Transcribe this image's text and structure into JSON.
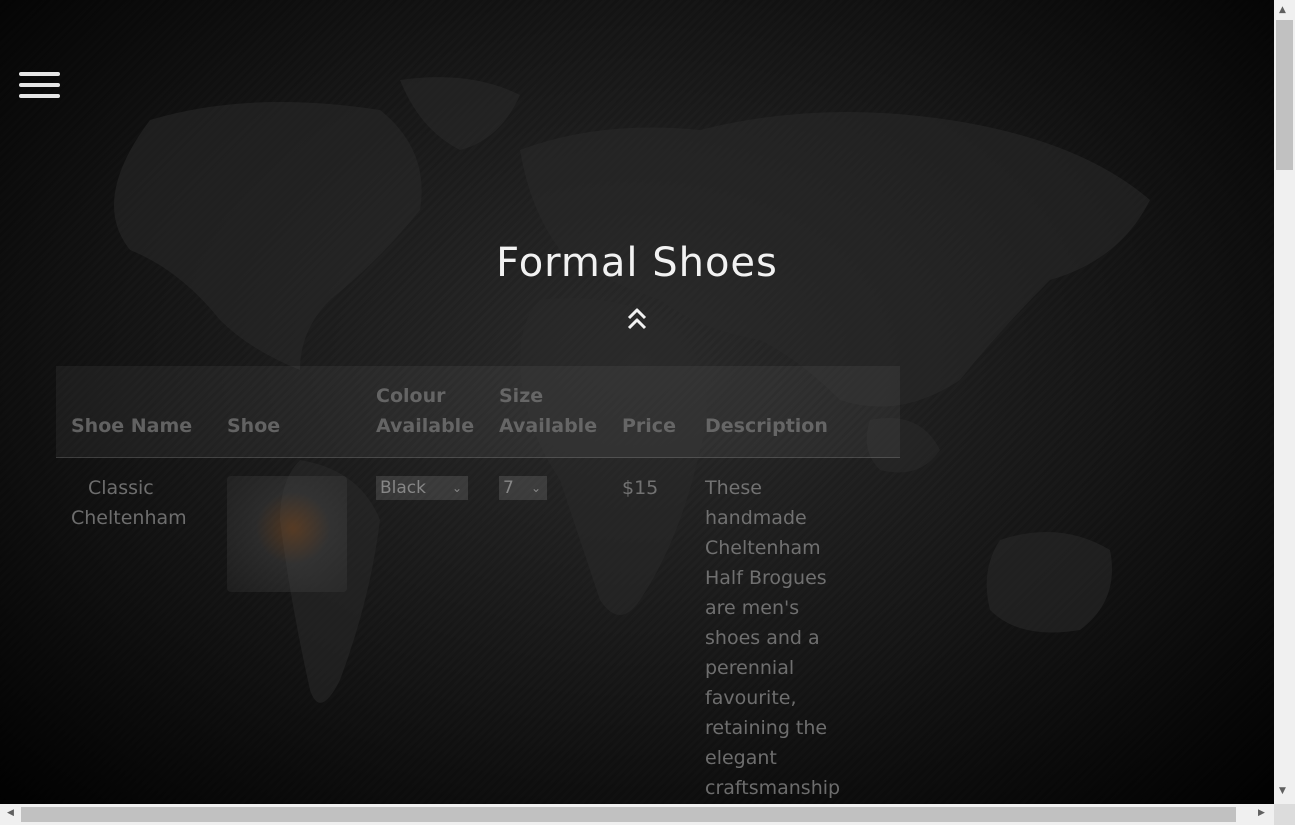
{
  "hero": {
    "title": "Formal Shoes"
  },
  "table": {
    "headers": {
      "name": "Shoe Name",
      "shoe": "Shoe",
      "colour_line1": "Colour",
      "colour_line2": "Available",
      "size_line1": "Size",
      "size_line2": "Available",
      "price": "Price",
      "description": "Description"
    },
    "rows": [
      {
        "name_line1": "Classic",
        "name_line2": "Cheltenham",
        "colour": "Black",
        "size": "7",
        "price": "$15",
        "description_lines": [
          "These",
          "handmade",
          "Cheltenham",
          "Half Brogues",
          "are men's",
          "shoes and a",
          "perennial",
          "favourite,",
          "retaining the",
          "elegant",
          "craftsmanship"
        ]
      }
    ]
  },
  "icons": {
    "menu": "hamburger-menu-icon",
    "scroll_up": "double-chevron-up-icon"
  }
}
